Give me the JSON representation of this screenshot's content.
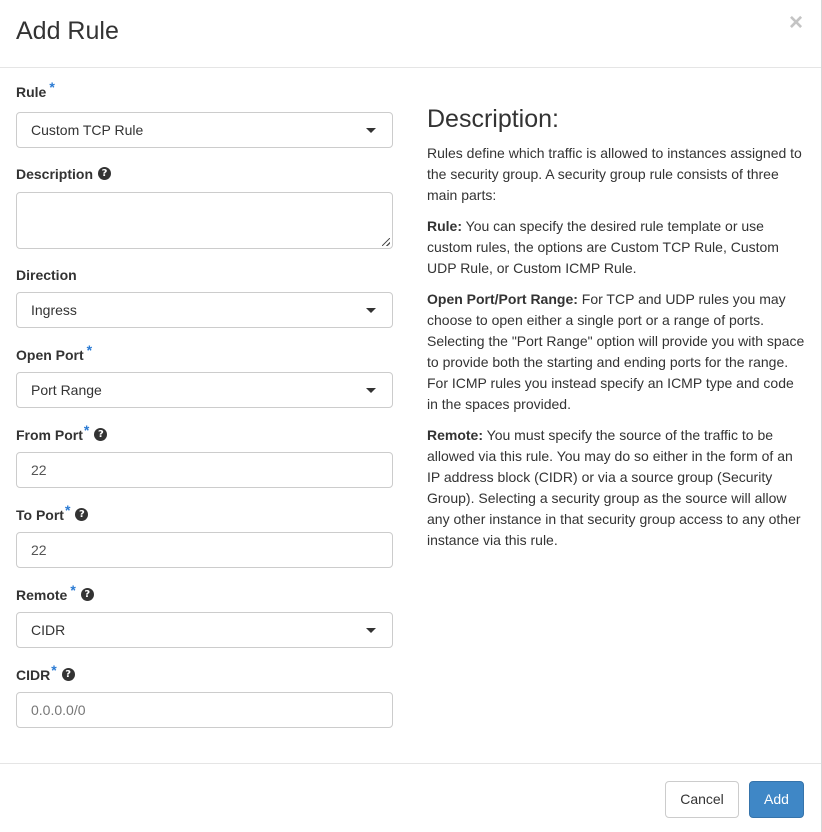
{
  "modal": {
    "title": "Add Rule",
    "close_glyph": "×"
  },
  "form": {
    "rule": {
      "label": "Rule",
      "required": "*",
      "value": "Custom TCP Rule"
    },
    "description": {
      "label": "Description",
      "help": "?",
      "value": ""
    },
    "direction": {
      "label": "Direction",
      "value": "Ingress"
    },
    "open_port": {
      "label": "Open Port",
      "required": "*",
      "value": "Port Range"
    },
    "from_port": {
      "label": "From Port",
      "required": "*",
      "help": "?",
      "value": "22"
    },
    "to_port": {
      "label": "To Port",
      "required": "*",
      "help": "?",
      "value": "22"
    },
    "remote": {
      "label": "Remote",
      "required": "*",
      "help": "?",
      "value": "CIDR"
    },
    "cidr": {
      "label": "CIDR",
      "required": "*",
      "help": "?",
      "placeholder": "0.0.0.0/0"
    }
  },
  "help_panel": {
    "heading": "Description:",
    "intro": "Rules define which traffic is allowed to instances assigned to the security group. A security group rule consists of three main parts:",
    "rule_term": "Rule:",
    "rule_text": " You can specify the desired rule template or use custom rules, the options are Custom TCP Rule, Custom UDP Rule, or Custom ICMP Rule.",
    "port_term": "Open Port/Port Range:",
    "port_text": " For TCP and UDP rules you may choose to open either a single port or a range of ports. Selecting the \"Port Range\" option will provide you with space to provide both the starting and ending ports for the range. For ICMP rules you instead specify an ICMP type and code in the spaces provided.",
    "remote_term": "Remote:",
    "remote_text": " You must specify the source of the traffic to be allowed via this rule. You may do so either in the form of an IP address block (CIDR) or via a source group (Security Group). Selecting a security group as the source will allow any other instance in that security group access to any other instance via this rule."
  },
  "footer": {
    "cancel_label": "Cancel",
    "add_label": "Add"
  },
  "colors": {
    "required_star": "#2a7ad3",
    "primary_button": "#3f87c6"
  },
  "icons": {
    "close": "close-icon",
    "help": "question-circle-icon",
    "caret": "caret-down-icon"
  }
}
